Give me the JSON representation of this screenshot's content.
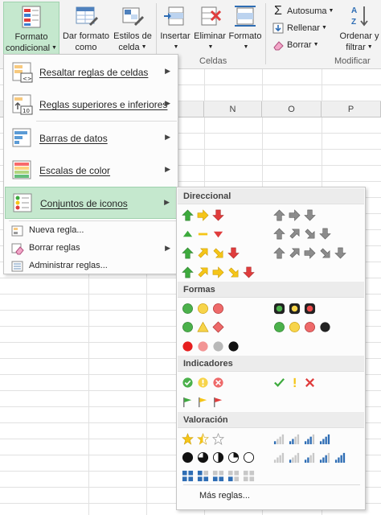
{
  "ribbon": {
    "buttons": [
      {
        "line1": "Formato",
        "line2": "condicional",
        "icon": "conditional-format-icon"
      },
      {
        "line1": "Dar formato",
        "line2": "como tabla",
        "icon": "format-as-table-icon"
      },
      {
        "line1": "Estilos de",
        "line2": "celda",
        "icon": "cell-styles-icon"
      },
      {
        "line1": "Insertar",
        "line2": "",
        "icon": "insert-cells-icon"
      },
      {
        "line1": "Eliminar",
        "line2": "",
        "icon": "delete-cells-icon"
      },
      {
        "line1": "Formato",
        "line2": "",
        "icon": "format-cells-icon"
      },
      {
        "line1": "Ordenar y",
        "line2": "filtrar",
        "icon": "sort-filter-icon"
      }
    ],
    "small": {
      "autosum": "Autosuma",
      "fill": "Rellenar",
      "clear": "Borrar"
    },
    "groups": {
      "cells": "Celdas",
      "editing": "Modificar"
    }
  },
  "sheet": {
    "columns": [
      "N",
      "O",
      "P"
    ]
  },
  "menu": {
    "items": [
      {
        "label": "Resaltar reglas de celdas",
        "icon": "highlight-rules-icon"
      },
      {
        "label": "Reglas superiores e inferiores",
        "icon": "top-bottom-rules-icon"
      },
      {
        "label": "Barras de datos",
        "icon": "data-bars-icon"
      },
      {
        "label": "Escalas de color",
        "icon": "color-scales-icon"
      },
      {
        "label": "Conjuntos de iconos",
        "icon": "icon-sets-icon"
      }
    ],
    "small_items": [
      {
        "label": "Nueva regla...",
        "icon": "new-rule-icon"
      },
      {
        "label": "Borrar reglas",
        "icon": "clear-rules-icon"
      },
      {
        "label": "Administrar reglas...",
        "icon": "manage-rules-icon"
      }
    ]
  },
  "submenu": {
    "sections": [
      "Direccional",
      "Formas",
      "Indicadores",
      "Valoración"
    ],
    "more_rules": "Más reglas..."
  },
  "colors": {
    "highlight": "#c5e8ce",
    "green": "#3daa3d",
    "yellow": "#f5c518",
    "red": "#e03c3c",
    "gray": "#7f7f7f",
    "blue": "#2e6db4"
  }
}
